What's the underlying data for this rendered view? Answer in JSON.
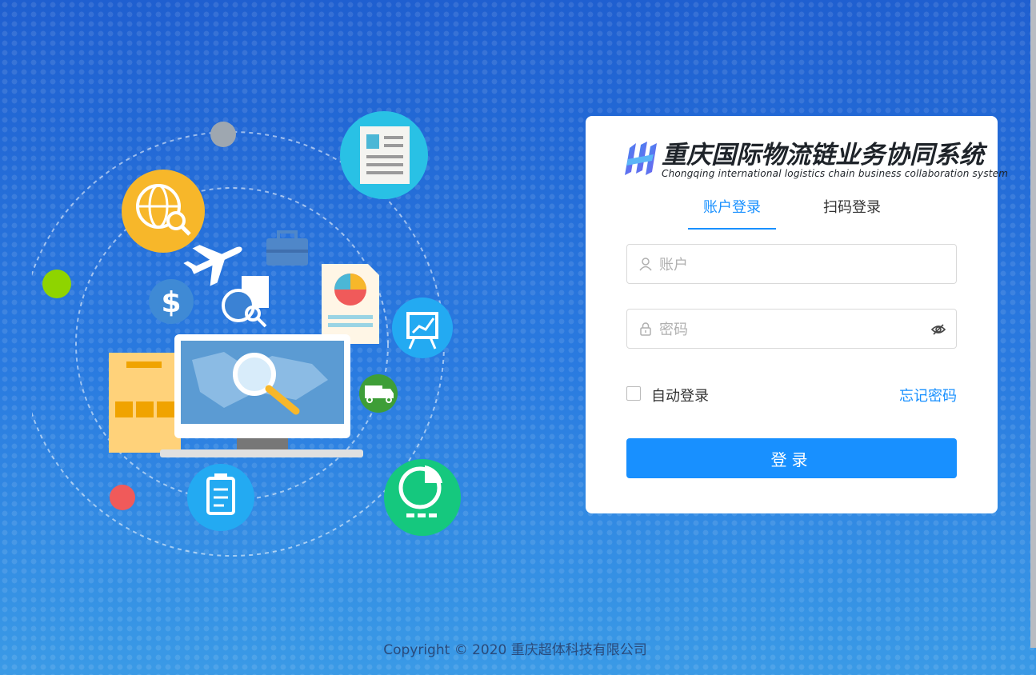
{
  "app": {
    "title_cn": "重庆国际物流链业务协同系统",
    "title_en": "Chongqing international logistics chain business collaboration system"
  },
  "tabs": [
    {
      "label": "账户登录",
      "active": true
    },
    {
      "label": "扫码登录",
      "active": false
    }
  ],
  "form": {
    "account_placeholder": "账户",
    "password_placeholder": "密码",
    "remember_label": "自动登录",
    "remember_checked": false,
    "forgot_label": "忘记密码",
    "submit_label": "登录"
  },
  "footer": {
    "copyright": "Copyright © 2020 重庆超体科技有限公司"
  },
  "icons": {
    "user": "user-icon",
    "lock": "lock-icon",
    "eye": "eye-off-icon"
  },
  "colors": {
    "primary": "#1890ff",
    "background_top": "#1f5fd0",
    "background_bottom": "#3a9ae6"
  }
}
